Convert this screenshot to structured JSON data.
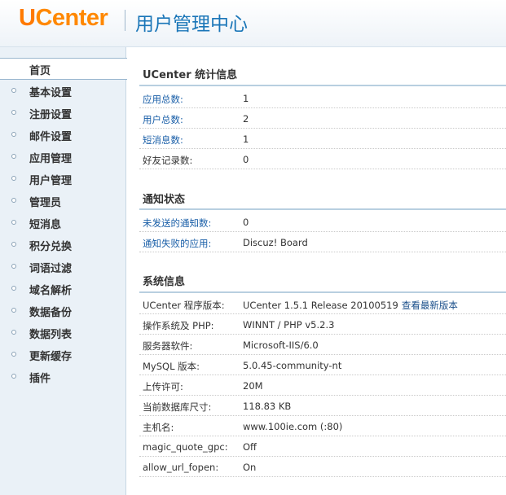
{
  "header": {
    "logo_u": "U",
    "logo_rest": "Center",
    "title": "用户管理中心"
  },
  "sidebar": {
    "items": [
      {
        "label": "首页",
        "active": true
      },
      {
        "label": "基本设置"
      },
      {
        "label": "注册设置"
      },
      {
        "label": "邮件设置"
      },
      {
        "label": "应用管理"
      },
      {
        "label": "用户管理"
      },
      {
        "label": "管理员"
      },
      {
        "label": "短消息"
      },
      {
        "label": "积分兑换"
      },
      {
        "label": "词语过滤"
      },
      {
        "label": "域名解析"
      },
      {
        "label": "数据备份"
      },
      {
        "label": "数据列表"
      },
      {
        "label": "更新缓存"
      },
      {
        "label": "插件"
      }
    ]
  },
  "stats": {
    "title": "UCenter 统计信息",
    "rows": [
      {
        "key": "应用总数:",
        "value": "1"
      },
      {
        "key": "用户总数:",
        "value": "2"
      },
      {
        "key": "短消息数:",
        "value": "1"
      },
      {
        "key": "好友记录数:",
        "value": "0"
      }
    ]
  },
  "notify": {
    "title": "通知状态",
    "rows": [
      {
        "key": "未发送的通知数:",
        "value": "0"
      },
      {
        "key": "通知失败的应用:",
        "value": "Discuz! Board"
      }
    ]
  },
  "system": {
    "title": "系统信息",
    "version_key": "UCenter 程序版本:",
    "version_value": "UCenter 1.5.1 Release 20100519",
    "version_link": "查看最新版本",
    "rows": [
      {
        "key": "操作系统及 PHP:",
        "value": "WINNT / PHP v5.2.3"
      },
      {
        "key": "服务器软件:",
        "value": "Microsoft-IIS/6.0"
      },
      {
        "key": "MySQL 版本:",
        "value": "5.0.45-community-nt"
      },
      {
        "key": "上传许可:",
        "value": "20M"
      },
      {
        "key": "当前数据库尺寸:",
        "value": "118.83 KB"
      },
      {
        "key": "主机名:",
        "value": "www.100ie.com (:80)"
      },
      {
        "key": "magic_quote_gpc:",
        "value": "Off"
      },
      {
        "key": "allow_url_fopen:",
        "value": "On"
      }
    ]
  }
}
